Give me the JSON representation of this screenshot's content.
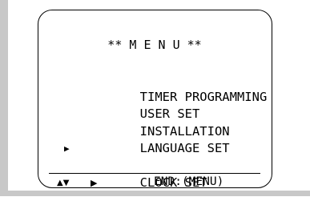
{
  "menu": {
    "title": "** M E N U **",
    "items": [
      {
        "label": "TIMER PROGRAMMING",
        "selected": false
      },
      {
        "label": "USER SET",
        "selected": false
      },
      {
        "label": "INSTALLATION",
        "selected": false
      },
      {
        "label": "LANGUAGE SET",
        "selected": false
      },
      {
        "label": "CLOCK SET",
        "selected": true
      }
    ],
    "cursor_glyph": "▶"
  },
  "footer": {
    "nav_updown": "▲▼",
    "nav_right": "▶",
    "end_hint": "END:(MENU)"
  },
  "colors": {
    "background": "#ffffff",
    "text": "#000000",
    "side_bar": "#c8c8c8"
  }
}
